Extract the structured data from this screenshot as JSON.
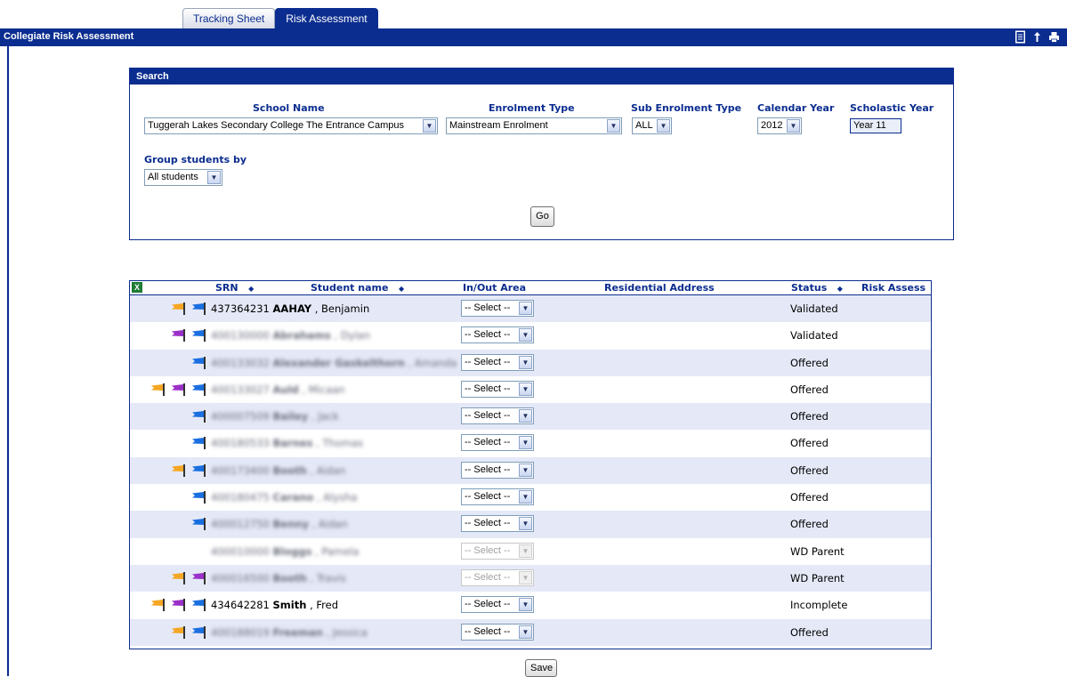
{
  "tabs": [
    {
      "label": "Tracking Sheet",
      "active": false
    },
    {
      "label": "Risk Assessment",
      "active": true
    }
  ],
  "header": {
    "title": "Collegiate Risk Assessment",
    "icons": [
      "report-icon",
      "upload-icon",
      "print-icon"
    ]
  },
  "search": {
    "title": "Search",
    "school_name": {
      "label": "School Name",
      "value": "Tuggerah Lakes Secondary College The Entrance Campus"
    },
    "enrolment_type": {
      "label": "Enrolment Type",
      "value": "Mainstream Enrolment"
    },
    "sub_enrolment_type": {
      "label": "Sub Enrolment Type",
      "value": "ALL"
    },
    "calendar_year": {
      "label": "Calendar Year",
      "value": "2012"
    },
    "scholastic_year": {
      "label": "Scholastic Year",
      "value": "Year 11"
    },
    "group_by": {
      "label": "Group students by",
      "value": "All students"
    },
    "go_label": "Go"
  },
  "table": {
    "columns": {
      "srn": "SRN",
      "student_name": "Student name",
      "in_out_area": "In/Out Area",
      "residential_address": "Residential Address",
      "status": "Status",
      "risk_assess": "Risk Assess"
    },
    "sort_glyph": "◆",
    "select_placeholder": "-- Select --",
    "rows": [
      {
        "flags": [
          "orange",
          "blue"
        ],
        "srn": "437364231",
        "surname": "AAHAY",
        "given": "Benjamin",
        "blurred": false,
        "select_disabled": false,
        "status": "Validated"
      },
      {
        "flags": [
          "purple",
          "blue"
        ],
        "srn": "400130000",
        "surname": "Abrahams",
        "given": "Dylan",
        "blurred": true,
        "select_disabled": false,
        "status": "Validated"
      },
      {
        "flags": [
          "blue"
        ],
        "srn": "400133032",
        "surname": "Alexander Gaskelthorn",
        "given": "Amanda",
        "blurred": true,
        "select_disabled": false,
        "status": "Offered"
      },
      {
        "flags": [
          "orange",
          "purple",
          "blue"
        ],
        "srn": "400133027",
        "surname": "Auld",
        "given": "Micaan",
        "blurred": true,
        "select_disabled": false,
        "status": "Offered"
      },
      {
        "flags": [
          "blue"
        ],
        "srn": "400007509",
        "surname": "Bailey",
        "given": "Jack",
        "blurred": true,
        "select_disabled": false,
        "status": "Offered"
      },
      {
        "flags": [
          "blue"
        ],
        "srn": "400180533",
        "surname": "Barnes",
        "given": "Thomas",
        "blurred": true,
        "select_disabled": false,
        "status": "Offered"
      },
      {
        "flags": [
          "orange",
          "blue"
        ],
        "srn": "400173400",
        "surname": "Booth",
        "given": "Aidan",
        "blurred": true,
        "select_disabled": false,
        "status": "Offered"
      },
      {
        "flags": [
          "blue"
        ],
        "srn": "400180475",
        "surname": "Carano",
        "given": "Alysha",
        "blurred": true,
        "select_disabled": false,
        "status": "Offered"
      },
      {
        "flags": [
          "blue"
        ],
        "srn": "400012750",
        "surname": "Benny",
        "given": "Aidan",
        "blurred": true,
        "select_disabled": false,
        "status": "Offered"
      },
      {
        "flags": [],
        "srn": "400010000",
        "surname": "Bloggs",
        "given": "Pamela",
        "blurred": true,
        "select_disabled": true,
        "status": "WD Parent"
      },
      {
        "flags": [
          "orange",
          "purple"
        ],
        "srn": "400016500",
        "surname": "Booth",
        "given": "Travis",
        "blurred": true,
        "select_disabled": true,
        "status": "WD Parent"
      },
      {
        "flags": [
          "orange",
          "purple",
          "blue"
        ],
        "srn": "434642281",
        "surname": "Smith",
        "given": "Fred",
        "blurred": false,
        "select_disabled": false,
        "status": "Incomplete"
      },
      {
        "flags": [
          "orange",
          "blue"
        ],
        "srn": "400188019",
        "surname": "Freeman",
        "given": "Jessica",
        "blurred": true,
        "select_disabled": false,
        "status": "Offered"
      }
    ]
  },
  "save_label": "Save",
  "colors": {
    "primary": "#0b2d8f",
    "row_alt": "#e5e9f7",
    "flag_orange": "#f5a623",
    "flag_purple": "#9b30c8",
    "flag_blue": "#1a6fe0"
  }
}
